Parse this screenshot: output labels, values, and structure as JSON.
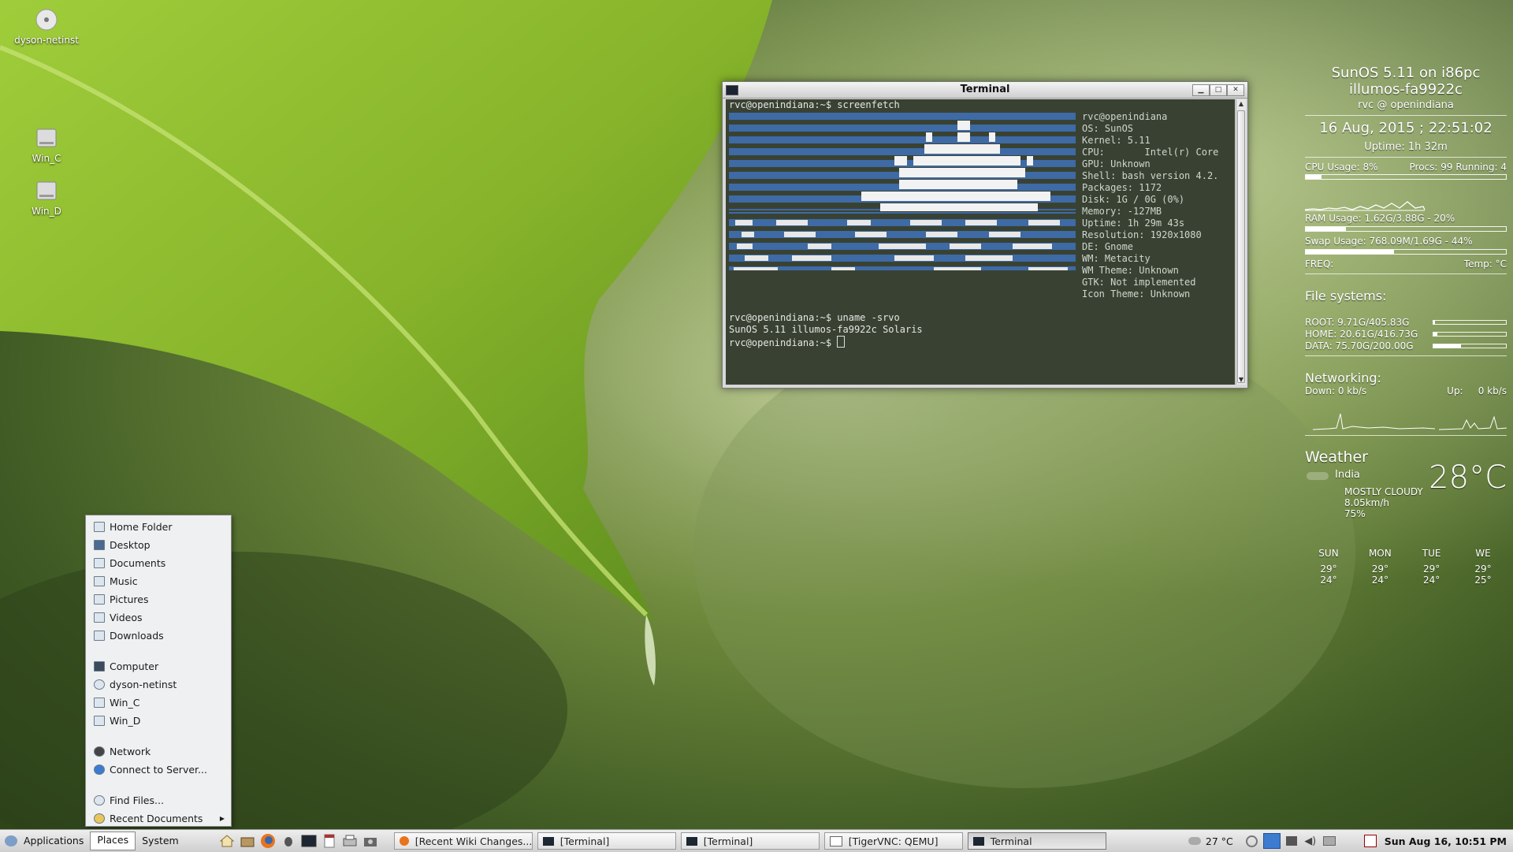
{
  "desktop": {
    "icons": [
      {
        "label": "dyson-netinst",
        "icon": "cd-icon"
      },
      {
        "label": "Win_C",
        "icon": "drive-icon"
      },
      {
        "label": "Win_D",
        "icon": "drive-icon"
      }
    ]
  },
  "terminal": {
    "title": "Terminal",
    "prompt1": "rvc@openindiana:~$ screenfetch",
    "fetch": [
      "rvc@openindiana",
      "OS: SunOS",
      "Kernel: 5.11",
      "CPU:       Intel(r) Core",
      "GPU: Unknown",
      "Shell: bash version 4.2.",
      "Packages: 1172",
      "Disk: 1G / 0G (0%)",
      "Memory: -127MB",
      "Uptime: 1h 29m 43s",
      "Resolution: 1920x1080",
      "DE: Gnome",
      "WM: Metacity",
      "WM Theme: Unknown",
      "GTK: Not implemented",
      "Icon Theme: Unknown"
    ],
    "prompt2": "rvc@openindiana:~$ uname -srvo",
    "output2": "SunOS 5.11 illumos-fa9922c Solaris",
    "prompt3": "rvc@openindiana:~$ "
  },
  "conky": {
    "os": "SunOS 5.11 on i86pc",
    "build": "illumos-fa9922c",
    "user": "rvc @ openindiana",
    "datetime": "16 Aug, 2015 ; 22:51:02",
    "uptime": "Uptime:  1h 32m",
    "cpu_usage": "CPU Usage: 8%",
    "procs": "Procs: 99 Running: 4",
    "cpu_fraction": 0.08,
    "ram_usage": "RAM Usage:  1.62G/3.88G - 20%",
    "ram_fraction": 0.2,
    "swap_usage": "Swap Usage: 768.09M/1.69G - 44%",
    "swap_fraction": 0.44,
    "freq": "FREQ:",
    "temp": "Temp:  °C",
    "fs_header": "File systems:",
    "filesystems": [
      {
        "label": "ROOT: 9.71G/405.83G",
        "fraction": 0.02
      },
      {
        "label": "HOME: 20.61G/416.73G",
        "fraction": 0.05
      },
      {
        "label": "DATA: 75.70G/200.00G",
        "fraction": 0.38
      }
    ],
    "net_header": "Networking:",
    "down": "Down: 0 kb/s",
    "up_label": "Up:",
    "up_value": "0 kb/s",
    "weather_header": "Weather",
    "location": "India",
    "temperature": "28°C",
    "condition": "MOSTLY CLOUDY",
    "wind": "8.05km/h",
    "humidity": "75%",
    "forecast": [
      {
        "day": "SUN",
        "high": "29°",
        "low": "24°"
      },
      {
        "day": "MON",
        "high": "29°",
        "low": "24°"
      },
      {
        "day": "TUE",
        "high": "29°",
        "low": "24°"
      },
      {
        "day": "WE",
        "high": "29°",
        "low": "25°"
      }
    ]
  },
  "places_menu": {
    "items": [
      "Home Folder",
      "Desktop",
      "Documents",
      "Music",
      "Pictures",
      "Videos",
      "Downloads",
      "Computer",
      "dyson-netinst",
      "Win_C",
      "Win_D",
      "Network",
      "Connect to Server...",
      "Find Files...",
      "Recent Documents"
    ]
  },
  "taskbar": {
    "menus": [
      "Applications",
      "Places",
      "System"
    ],
    "tasks": [
      "[Recent Wiki Changes...",
      "[Terminal]",
      "[Terminal]",
      "[TigerVNC: QEMU]",
      "Terminal"
    ],
    "weather": "27 °C",
    "clock": "Sun Aug 16, 10:51 PM"
  },
  "colors": {
    "terminal_bg": "#222c1a",
    "logo_blue": "#3f6fb3",
    "taskbar": "#dedede"
  }
}
